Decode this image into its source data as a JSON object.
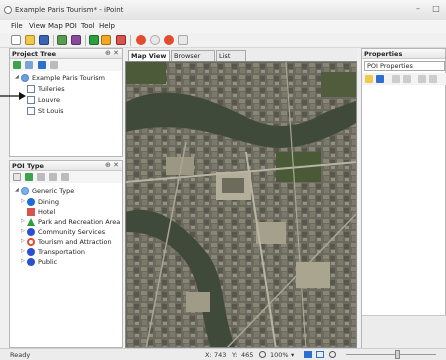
{
  "window": {
    "title": "Example Paris Tourism* - iPoint",
    "min_glyph": "–",
    "max_glyph": "□"
  },
  "menu": [
    "File",
    "View",
    "Map",
    "POI",
    "Tool",
    "Help"
  ],
  "project_tree": {
    "title": "Project Tree",
    "buttons": "⊕ ✕",
    "root": "Example Paris Tourism",
    "items": [
      "Tuileries",
      "Louvre",
      "St Louis"
    ]
  },
  "poi_type": {
    "title": "POI Type",
    "buttons": "⊕ ✕",
    "root": "Generic Type",
    "items": [
      {
        "label": "Dining",
        "color": "#1e6ad6"
      },
      {
        "label": "Hotel",
        "color": "#d9534f"
      },
      {
        "label": "Park and Recreation Area",
        "color": "#2e9e3e"
      },
      {
        "label": "Community Services",
        "color": "#2c4fd1"
      },
      {
        "label": "Tourism and Attraction",
        "color": "#e24b2d"
      },
      {
        "label": "Transportation",
        "color": "#2c4fd1"
      },
      {
        "label": "Public",
        "color": "#2c4fd1"
      }
    ]
  },
  "map": {
    "tabs": [
      "Map View",
      "Browser View",
      "List View"
    ],
    "active_tab": "Map View"
  },
  "properties": {
    "title": "Properties",
    "selector": "POI Properties"
  },
  "status": {
    "state": "Ready",
    "x_label": "X:",
    "x_value": "743",
    "y_label": "Y:",
    "y_value": "465",
    "zoom": "100%"
  },
  "colors": {
    "accent": "#1e6ad6",
    "callout": "#111111"
  }
}
